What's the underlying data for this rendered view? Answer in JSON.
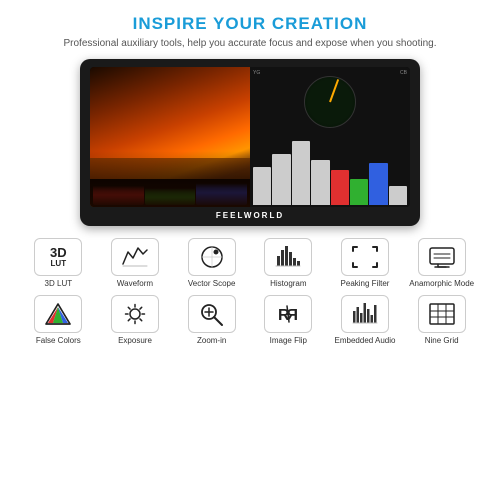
{
  "header": {
    "headline": "INSPIRE YOUR CREATION",
    "subline": "Professional auxiliary tools, help you accurate focus and expose when you shooting."
  },
  "monitor": {
    "brand": "FEELWORLD"
  },
  "icons": [
    {
      "id": "3d-lut",
      "label": "3D LUT",
      "type": "3dlut"
    },
    {
      "id": "waveform",
      "label": "Waveform",
      "type": "waveform"
    },
    {
      "id": "vector-scope",
      "label": "Vector Scope",
      "type": "vectorscope"
    },
    {
      "id": "histogram",
      "label": "Histogram",
      "type": "histogram"
    },
    {
      "id": "peaking",
      "label": "Peaking Filter",
      "type": "peaking"
    },
    {
      "id": "anamorphic",
      "label": "Anamorphic Mode",
      "type": "anamorphic"
    },
    {
      "id": "false-colors",
      "label": "False Colors",
      "type": "falsecolors"
    },
    {
      "id": "exposure",
      "label": "Exposure",
      "type": "exposure"
    },
    {
      "id": "zoom-in",
      "label": "Zoom-in",
      "type": "zoomin"
    },
    {
      "id": "image-flip",
      "label": "Image Flip",
      "type": "imageflip"
    },
    {
      "id": "audio",
      "label": "Embedded Audio",
      "type": "audio"
    },
    {
      "id": "nine-grid",
      "label": "Nine Grid",
      "type": "ninegrid"
    }
  ]
}
